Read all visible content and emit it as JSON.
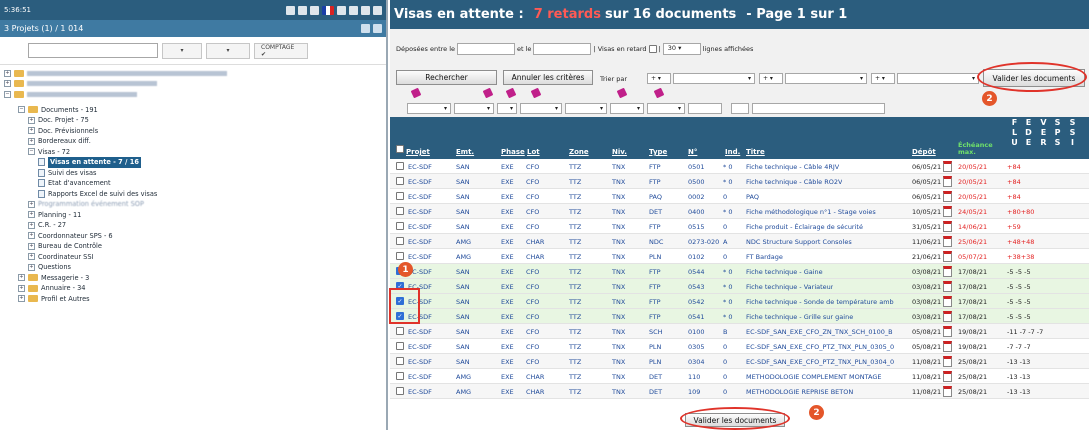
{
  "left": {
    "time": "5:36:51",
    "projects_label": "3 Projets (1) / 1 014",
    "search_placeholder": "",
    "comptage_label": "COMPTAGE ✔",
    "tree": [
      {
        "label": "Documents - 191",
        "level": 1,
        "icon": "folder-icon",
        "exp": "−"
      },
      {
        "label": "Doc. Projet - 75",
        "level": 2,
        "icon": "",
        "exp": "+"
      },
      {
        "label": "Doc. Prévisionnels",
        "level": 2,
        "icon": "",
        "exp": "+"
      },
      {
        "label": "Bordereaux diff.",
        "level": 2,
        "icon": "",
        "exp": "+"
      },
      {
        "label": "Visas - 72",
        "level": 2,
        "icon": "",
        "exp": "−"
      },
      {
        "label": "Visas en attente - 7 / 16",
        "level": 3,
        "icon": "page-icon",
        "exp": "",
        "selected": true
      },
      {
        "label": "Suivi des visas",
        "level": 3,
        "icon": "page-icon",
        "exp": ""
      },
      {
        "label": "Etat d'avancement",
        "level": 3,
        "icon": "page-icon",
        "exp": ""
      },
      {
        "label": "Rapports Excel de suivi des visas",
        "level": 3,
        "icon": "page-icon",
        "exp": ""
      },
      {
        "label": "Programmation événement SOP",
        "level": 2,
        "icon": "",
        "exp": "+",
        "blur": true
      },
      {
        "label": "Planning - 11",
        "level": 2,
        "icon": "",
        "exp": "+"
      },
      {
        "label": "C.R. - 27",
        "level": 2,
        "icon": "",
        "exp": "+"
      },
      {
        "label": "Coordonnateur SPS - 6",
        "level": 2,
        "icon": "",
        "exp": "+"
      },
      {
        "label": "Bureau de Contrôle",
        "level": 2,
        "icon": "",
        "exp": "+"
      },
      {
        "label": "Coordinateur SSI",
        "level": 2,
        "icon": "",
        "exp": "+"
      },
      {
        "label": "Questions",
        "level": 2,
        "icon": "",
        "exp": "+"
      },
      {
        "label": "Messagerie - 3",
        "level": 1,
        "icon": "folder-icon",
        "exp": "+"
      },
      {
        "label": "Annuaire - 34",
        "level": 1,
        "icon": "folder-icon",
        "exp": "+"
      },
      {
        "label": "Profil et Autres",
        "level": 1,
        "icon": "folder-icon",
        "exp": "+"
      }
    ]
  },
  "header": {
    "title": "Visas en attente :",
    "late": "7 retards",
    "rest": "sur 16 documents",
    "page": "- Page 1 sur 1"
  },
  "filters": {
    "deposited_label": "Déposées entre le",
    "and_label": "et le",
    "late_label": "| Visas en retard",
    "sep": "|",
    "rows_value": "30",
    "rows_label": "lignes affichées",
    "search_btn": "Rechercher",
    "reset_btn": "Annuler les critères",
    "sort_label": "Trier par",
    "sort_value": "+",
    "validate_btn": "Valider les documents"
  },
  "table": {
    "headers": {
      "projet": "Projet",
      "emt": "Emt.",
      "phase": "Phase",
      "lot": "Lot",
      "zone": "Zone",
      "niv": "Niv.",
      "type": "Type",
      "num": "N°",
      "ind": "Ind.",
      "titre": "Titre",
      "depot": "Dépôt",
      "echeance": "Échéance max."
    },
    "letters": [
      [
        "F",
        "L",
        "U"
      ],
      [
        "E",
        "D",
        "E"
      ],
      [
        "V",
        "E",
        "R"
      ],
      [
        "S",
        "P",
        "S"
      ],
      [
        "S",
        "S",
        "I"
      ]
    ],
    "rows": [
      {
        "projet": "EC-SDF",
        "emt": "SAN",
        "phase": "EXE",
        "lot": "CFO",
        "zone": "TTZ",
        "niv": "TNX",
        "type": "FTP",
        "num": "0501",
        "ind": "* 0",
        "titre": "Fiche technique - Câble 4RJV",
        "depot": "06/05/21",
        "ech": "20/05/21",
        "late": true,
        "v": "+84",
        "chk": false
      },
      {
        "projet": "EC-SDF",
        "emt": "SAN",
        "phase": "EXE",
        "lot": "CFO",
        "zone": "TTZ",
        "niv": "TNX",
        "type": "FTP",
        "num": "0500",
        "ind": "* 0",
        "titre": "Fiche technique - Câble RO2V",
        "depot": "06/05/21",
        "ech": "20/05/21",
        "late": true,
        "v": "+84",
        "chk": false
      },
      {
        "projet": "EC-SDF",
        "emt": "SAN",
        "phase": "EXE",
        "lot": "CFO",
        "zone": "TTZ",
        "niv": "TNX",
        "type": "PAQ",
        "num": "0002",
        "ind": "0",
        "titre": "PAQ",
        "depot": "06/05/21",
        "ech": "20/05/21",
        "late": true,
        "v": "+84",
        "chk": false
      },
      {
        "projet": "EC-SDF",
        "emt": "SAN",
        "phase": "EXE",
        "lot": "CFO",
        "zone": "TTZ",
        "niv": "TNX",
        "type": "DET",
        "num": "0400",
        "ind": "* 0",
        "titre": "Fiche méthodologique n°1 - Stage voies",
        "depot": "10/05/21",
        "ech": "24/05/21",
        "late": true,
        "v": "+80+80",
        "chk": false
      },
      {
        "projet": "EC-SDF",
        "emt": "SAN",
        "phase": "EXE",
        "lot": "CFO",
        "zone": "TTZ",
        "niv": "TNX",
        "type": "FTP",
        "num": "0515",
        "ind": "0",
        "titre": "Fiche produit - Éclairage de sécurité",
        "depot": "31/05/21",
        "ech": "14/06/21",
        "late": true,
        "v": "+59",
        "chk": false
      },
      {
        "projet": "EC-SDF",
        "emt": "AMG",
        "phase": "EXE",
        "lot": "CHAR",
        "zone": "TTZ",
        "niv": "TNX",
        "type": "NDC",
        "num": "0273-020",
        "ind": "A",
        "titre": "NDC Structure Support Consoles",
        "depot": "11/06/21",
        "ech": "25/06/21",
        "late": true,
        "v": "+48+48",
        "chk": false
      },
      {
        "projet": "EC-SDF",
        "emt": "AMG",
        "phase": "EXE",
        "lot": "CHAR",
        "zone": "TTZ",
        "niv": "TNX",
        "type": "PLN",
        "num": "0102",
        "ind": "0",
        "titre": "FT Bardage",
        "depot": "21/06/21",
        "ech": "05/07/21",
        "late": true,
        "v": "+38+38",
        "chk": false
      },
      {
        "projet": "EC-SDF",
        "emt": "SAN",
        "phase": "EXE",
        "lot": "CFO",
        "zone": "TTZ",
        "niv": "TNX",
        "type": "FTP",
        "num": "0544",
        "ind": "* 0",
        "titre": "Fiche technique - Gaine",
        "depot": "03/08/21",
        "ech": "17/08/21",
        "late": false,
        "v": "-5  -5  -5",
        "chk": true
      },
      {
        "projet": "EC-SDF",
        "emt": "SAN",
        "phase": "EXE",
        "lot": "CFO",
        "zone": "TTZ",
        "niv": "TNX",
        "type": "FTP",
        "num": "0543",
        "ind": "* 0",
        "titre": "Fiche technique - Variateur",
        "depot": "03/08/21",
        "ech": "17/08/21",
        "late": false,
        "v": "-5  -5  -5",
        "chk": true
      },
      {
        "projet": "EC-SDF",
        "emt": "SAN",
        "phase": "EXE",
        "lot": "CFO",
        "zone": "TTZ",
        "niv": "TNX",
        "type": "FTP",
        "num": "0542",
        "ind": "* 0",
        "titre": "Fiche technique - Sonde de température ambiante",
        "depot": "03/08/21",
        "ech": "17/08/21",
        "late": false,
        "v": "-5  -5  -5",
        "chk": true
      },
      {
        "projet": "EC-SDF",
        "emt": "SAN",
        "phase": "EXE",
        "lot": "CFO",
        "zone": "TTZ",
        "niv": "TNX",
        "type": "FTP",
        "num": "0541",
        "ind": "* 0",
        "titre": "Fiche technique - Grille sur gaine",
        "depot": "03/08/21",
        "ech": "17/08/21",
        "late": false,
        "v": "-5  -5  -5",
        "chk": true
      },
      {
        "projet": "EC-SDF",
        "emt": "SAN",
        "phase": "EXE",
        "lot": "CFO",
        "zone": "TTZ",
        "niv": "TNX",
        "type": "SCH",
        "num": "0100",
        "ind": "B",
        "titre": "EC-SDF_SAN_EXE_CFO_ZN_TNX_SCH_0100_B",
        "depot": "05/08/21",
        "ech": "19/08/21",
        "late": false,
        "v": "-11  -7  -7    -7",
        "chk": false
      },
      {
        "projet": "EC-SDF",
        "emt": "SAN",
        "phase": "EXE",
        "lot": "CFO",
        "zone": "TTZ",
        "niv": "TNX",
        "type": "PLN",
        "num": "0305",
        "ind": "0",
        "titre": "EC-SDF_SAN_EXE_CFO_PTZ_TNX_PLN_0305_0",
        "depot": "05/08/21",
        "ech": "19/08/21",
        "late": false,
        "v": "-7  -7  -7",
        "chk": false
      },
      {
        "projet": "EC-SDF",
        "emt": "SAN",
        "phase": "EXE",
        "lot": "CFO",
        "zone": "TTZ",
        "niv": "TNX",
        "type": "PLN",
        "num": "0304",
        "ind": "0",
        "titre": "EC-SDF_SAN_EXE_CFO_PTZ_TNX_PLN_0304_0",
        "depot": "11/08/21",
        "ech": "25/08/21",
        "late": false,
        "v": "-13 -13",
        "chk": false
      },
      {
        "projet": "EC-SDF",
        "emt": "AMG",
        "phase": "EXE",
        "lot": "CHAR",
        "zone": "TTZ",
        "niv": "TNX",
        "type": "DET",
        "num": "110",
        "ind": "0",
        "titre": "METHODOLOGIE COMPLEMENT MONTAGE",
        "depot": "11/08/21",
        "ech": "25/08/21",
        "late": false,
        "v": "-13 -13",
        "chk": false
      },
      {
        "projet": "EC-SDF",
        "emt": "AMG",
        "phase": "EXE",
        "lot": "CHAR",
        "zone": "TTZ",
        "niv": "TNX",
        "type": "DET",
        "num": "109",
        "ind": "0",
        "titre": "METHODOLOGIE REPRISE BETON",
        "depot": "11/08/21",
        "ech": "25/08/21",
        "late": false,
        "v": "-13 -13",
        "chk": false
      }
    ]
  },
  "annotations": {
    "badge1": "1",
    "badge2": "2"
  },
  "colors": {
    "header": "#2b5d7e",
    "late": "#e32222",
    "link": "#1f4a9a",
    "accent_green": "#1e9a1e"
  }
}
